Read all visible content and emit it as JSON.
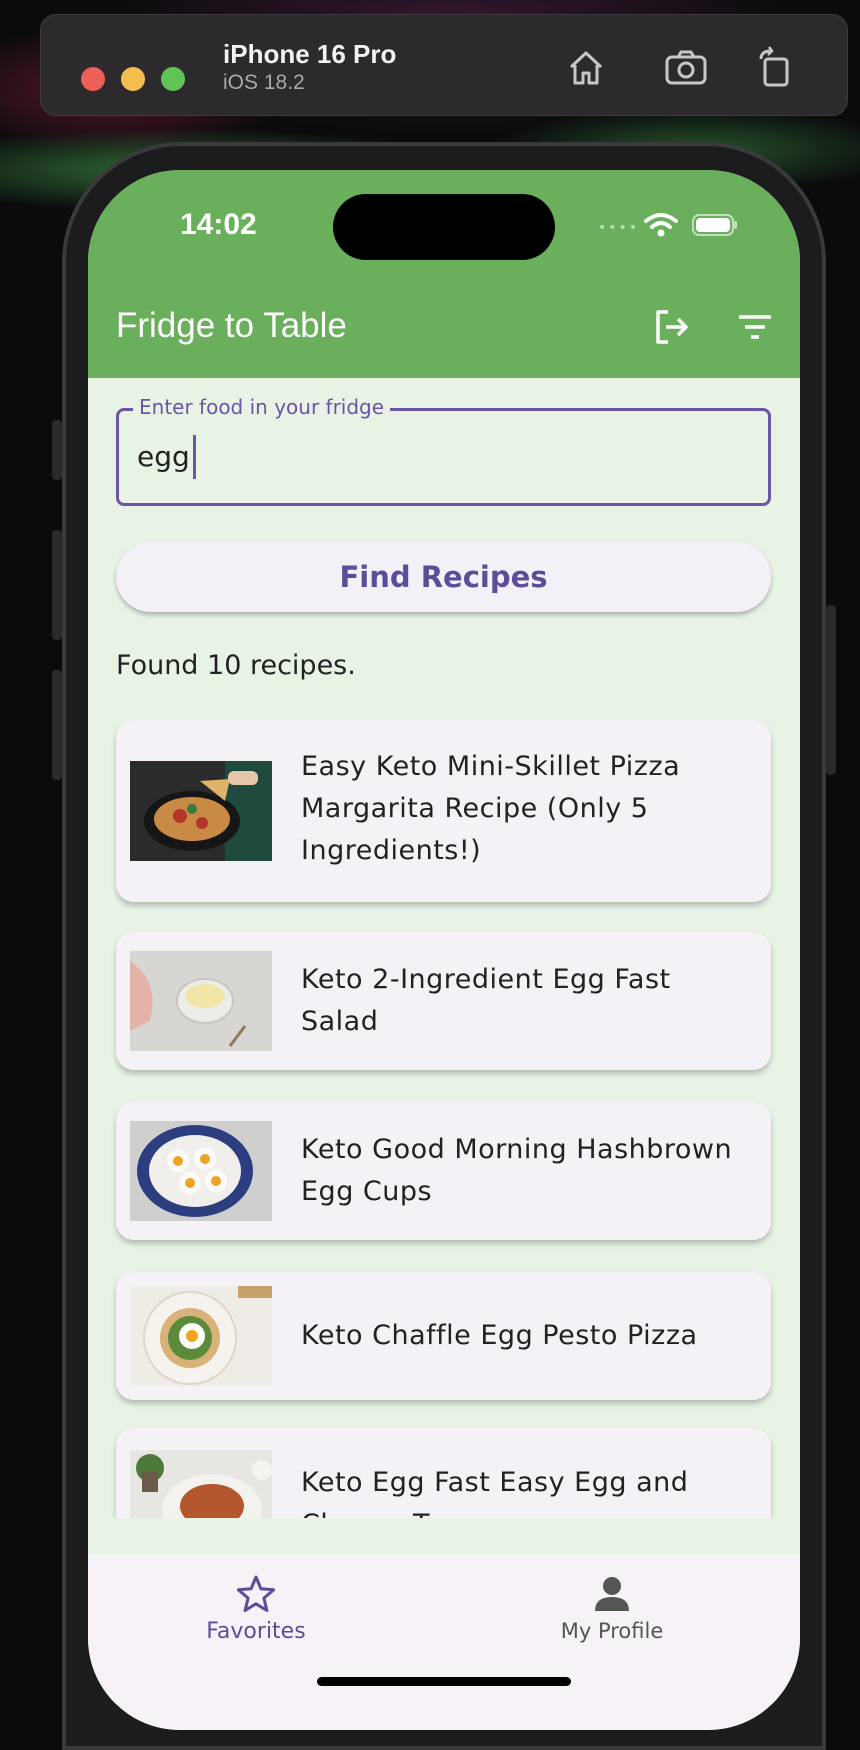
{
  "simulator": {
    "device": "iPhone 16 Pro",
    "os": "iOS 18.2",
    "icons": [
      "home-icon",
      "screenshot-icon",
      "rotate-icon"
    ]
  },
  "status_bar": {
    "time": "14:02",
    "icons": [
      "wifi-icon",
      "battery-icon"
    ]
  },
  "app_bar": {
    "title": "Fridge to Table",
    "actions": [
      "logout-icon",
      "filter-icon"
    ],
    "color": "#6aaf5c"
  },
  "search": {
    "label": "Enter food in your fridge",
    "value": "egg",
    "accent": "#6a55a6"
  },
  "find_button": {
    "label": "Find Recipes"
  },
  "results": {
    "summary": "Found 10 recipes.",
    "recipes": [
      {
        "title": "Easy Keto Mini-Skillet Pizza Margarita Recipe (Only 5 Ingredients!)"
      },
      {
        "title": "Keto 2-Ingredient Egg Fast Salad"
      },
      {
        "title": "Keto Good Morning Hashbrown Egg Cups"
      },
      {
        "title": "Keto Chaffle Egg Pesto Pizza"
      },
      {
        "title": "Keto Egg Fast Easy Egg and Cheese Tacos"
      }
    ]
  },
  "bottom_nav": {
    "items": [
      {
        "label": "Favorites",
        "icon": "star-icon",
        "selected": true
      },
      {
        "label": "My Profile",
        "icon": "person-icon",
        "selected": false
      }
    ]
  }
}
